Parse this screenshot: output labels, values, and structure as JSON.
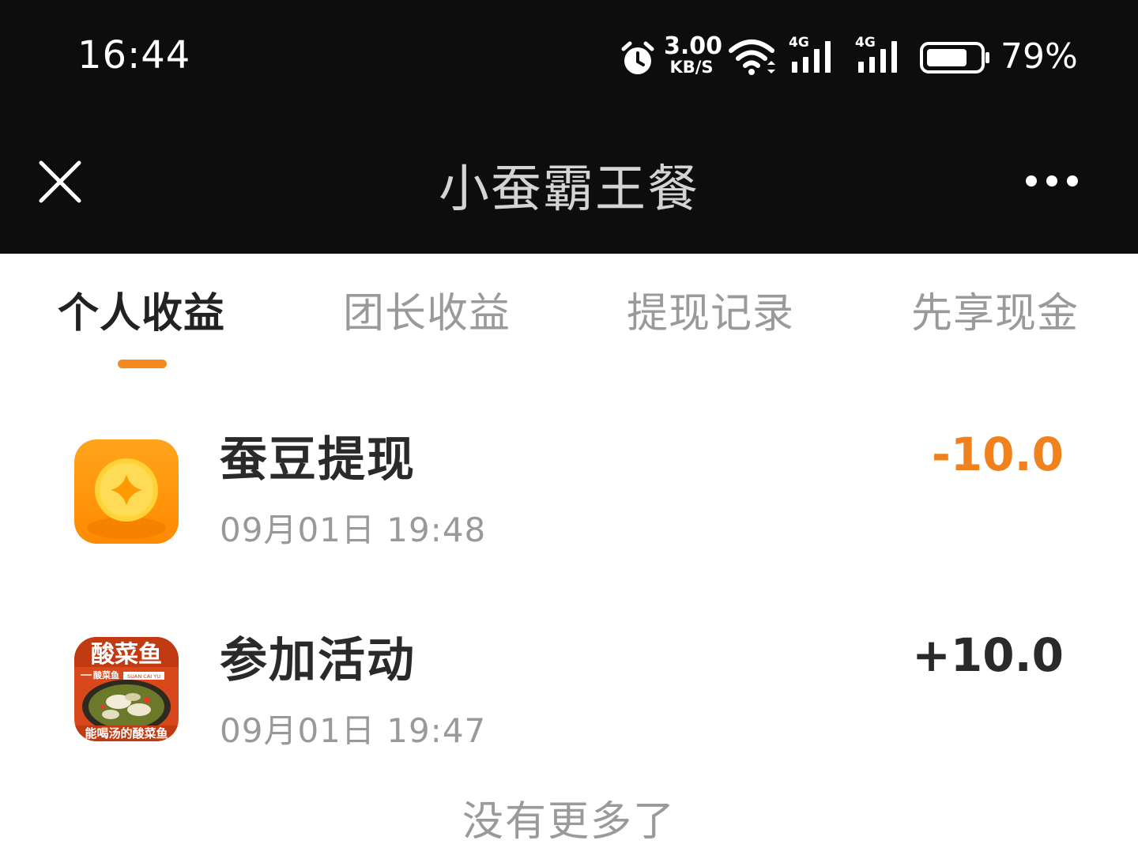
{
  "status_bar": {
    "time": "16:44",
    "net_speed_value": "3.00",
    "net_speed_unit": "KB/S",
    "signal1_label": "4G",
    "signal2_label": "4G",
    "battery": "79%",
    "icons": [
      "alarm-icon",
      "wifi-icon",
      "cell-signal-icon",
      "cell-signal-icon",
      "battery-icon"
    ]
  },
  "header": {
    "title": "小蚕霸王餐",
    "close_icon": "close-icon",
    "more_icon": "more-icon"
  },
  "tabs": [
    {
      "label": "个人收益",
      "active": true
    },
    {
      "label": "团长收益",
      "active": false
    },
    {
      "label": "提现记录",
      "active": false
    },
    {
      "label": "先享现金",
      "active": false
    }
  ],
  "records": [
    {
      "title": "蚕豆提现",
      "time": "09月01日 19:48",
      "amount": "-10.0",
      "icon": "coin-icon"
    },
    {
      "title": "参加活动",
      "time": "09月01日 19:47",
      "amount": "+10.0",
      "icon": "food-thumbnail",
      "thumbnail": {
        "headline": "酸菜鱼",
        "subtitle": "酸菜鱼",
        "subtitle_en": "SUAN CAI YU",
        "footer": "能喝汤的酸菜鱼"
      }
    }
  ],
  "footer_text": "没有更多了",
  "colors": {
    "accent": "#f58a1f",
    "negative_amount": "#f0821e",
    "bar_background": "#0d0d0d"
  }
}
